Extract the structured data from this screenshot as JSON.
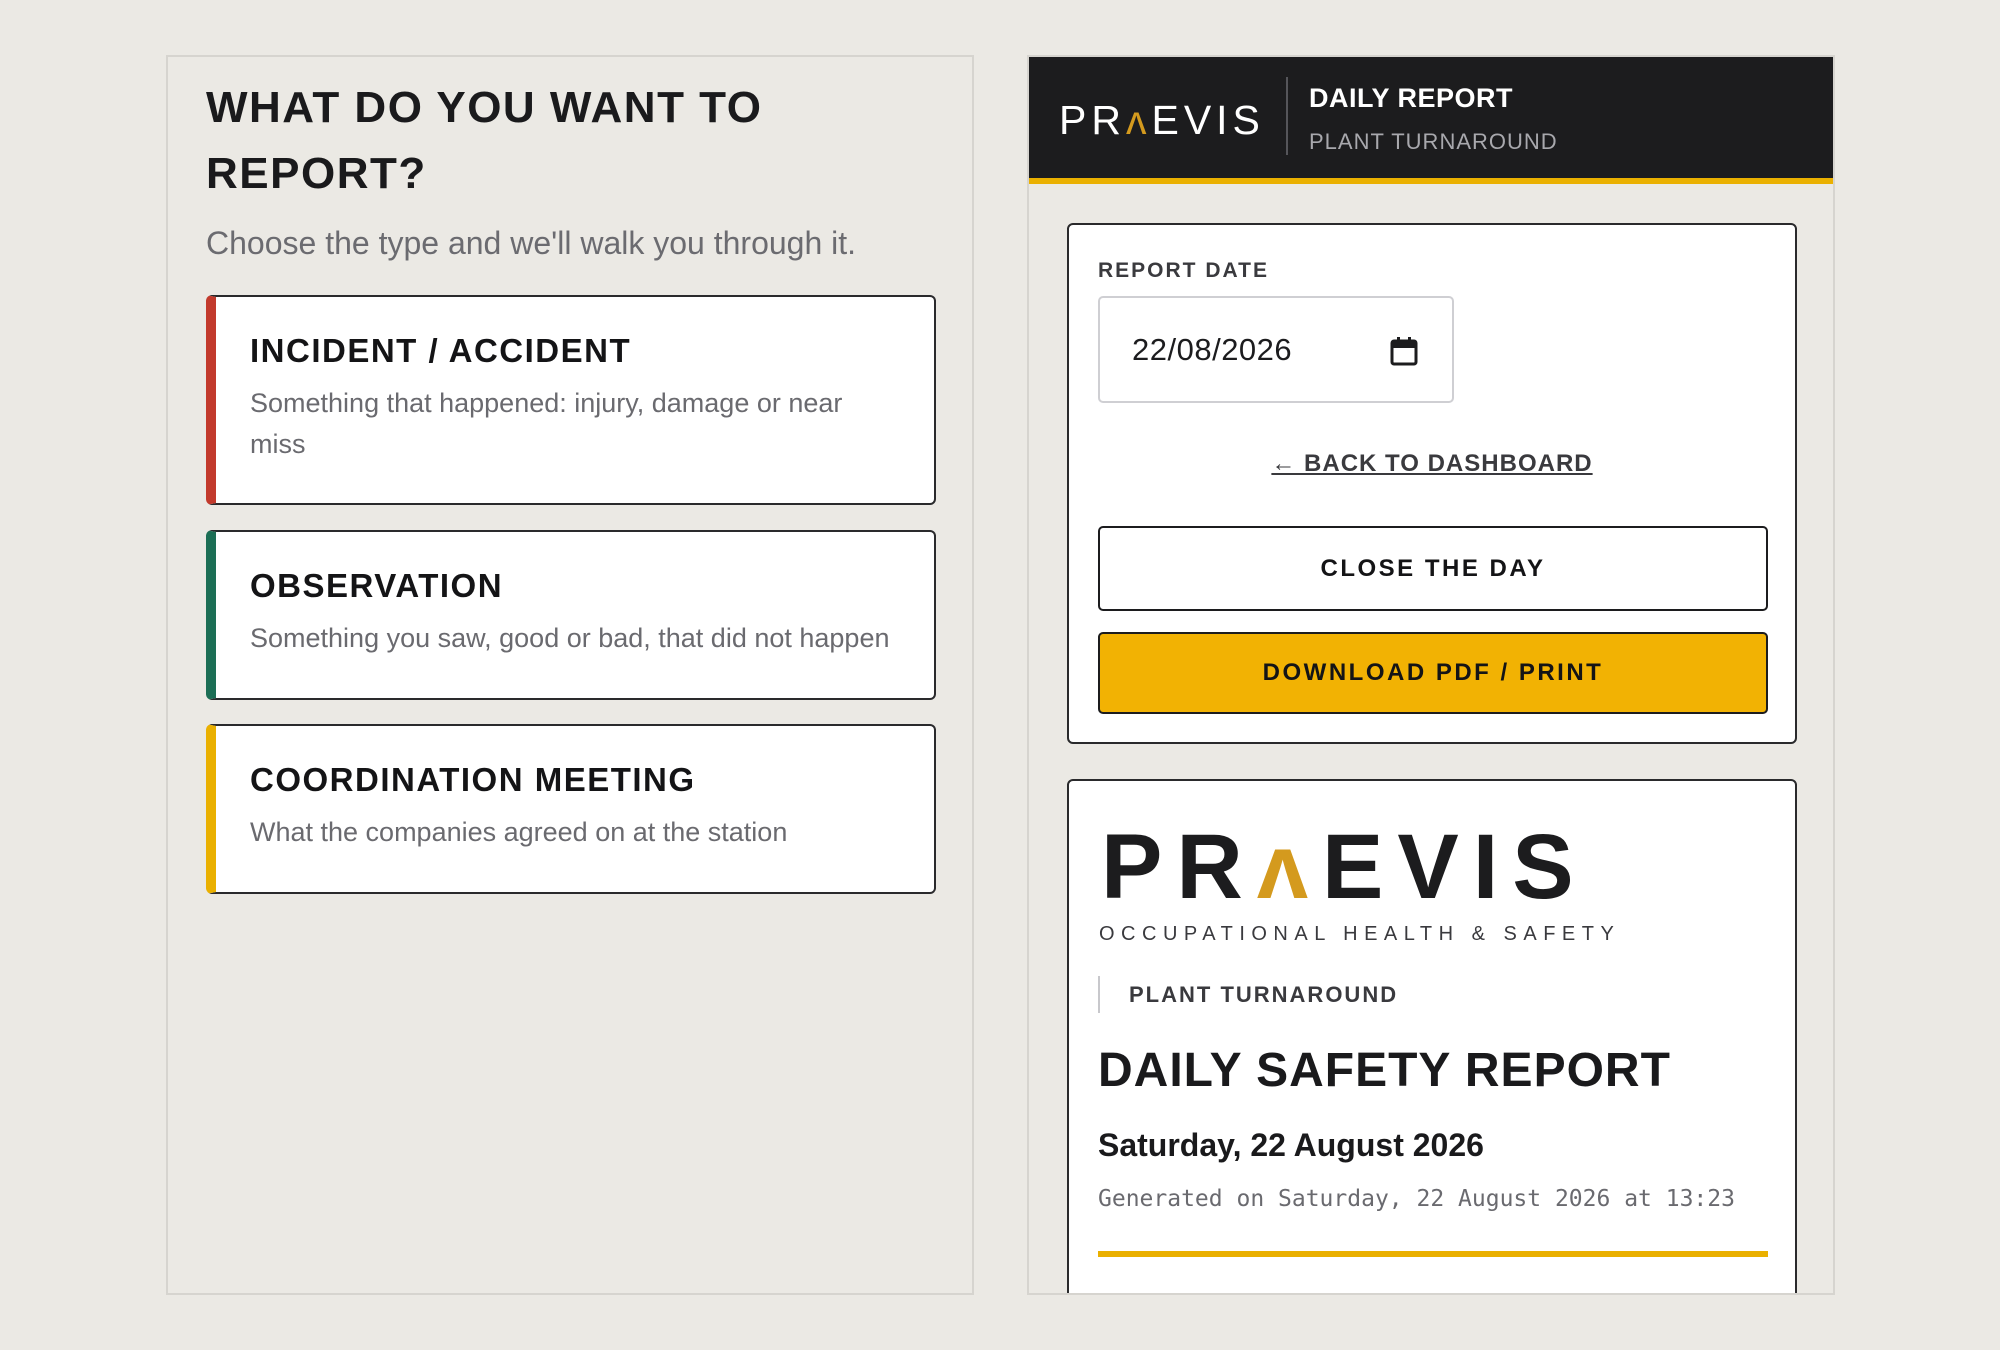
{
  "report_type": {
    "title": "WHAT DO YOU WANT TO REPORT?",
    "subtitle": "Choose the type and we'll walk you through it.",
    "options": [
      {
        "title": "INCIDENT / ACCIDENT",
        "description": "Something that happened: injury, damage or near miss",
        "accent": "#c23a2c"
      },
      {
        "title": "OBSERVATION",
        "description": "Something you saw, good or bad, that did not happen",
        "accent": "#1c6e55"
      },
      {
        "title": "COORDINATION MEETING",
        "description": "What the companies agreed on at the station",
        "accent": "#eab000"
      }
    ]
  },
  "header": {
    "logo_pre": "PR",
    "logo_accent": "ʌ",
    "logo_post": "EVIS",
    "title": "DAILY REPORT",
    "subtitle": "PLANT TURNAROUND"
  },
  "controls": {
    "date_label": "REPORT DATE",
    "date_value": "22/08/2026",
    "calendar_icon": "calendar-icon",
    "back_link": "← BACK TO DASHBOARD",
    "close_day_label": "CLOSE THE DAY",
    "download_label": "DOWNLOAD PDF / PRINT"
  },
  "report_preview": {
    "logo_pre": "PR",
    "logo_accent": "ʌ",
    "logo_post": "EVIS",
    "logo_sub": "OCCUPATIONAL HEALTH & SAFETY",
    "site": "PLANT TURNAROUND",
    "title": "DAILY SAFETY REPORT",
    "date": "Saturday, 22 August 2026",
    "generated": "Generated on Saturday, 22 August 2026 at 13:23"
  },
  "colors": {
    "brand_yellow": "#f2b203",
    "dark": "#1c1c1e",
    "background": "#ebe9e4"
  }
}
